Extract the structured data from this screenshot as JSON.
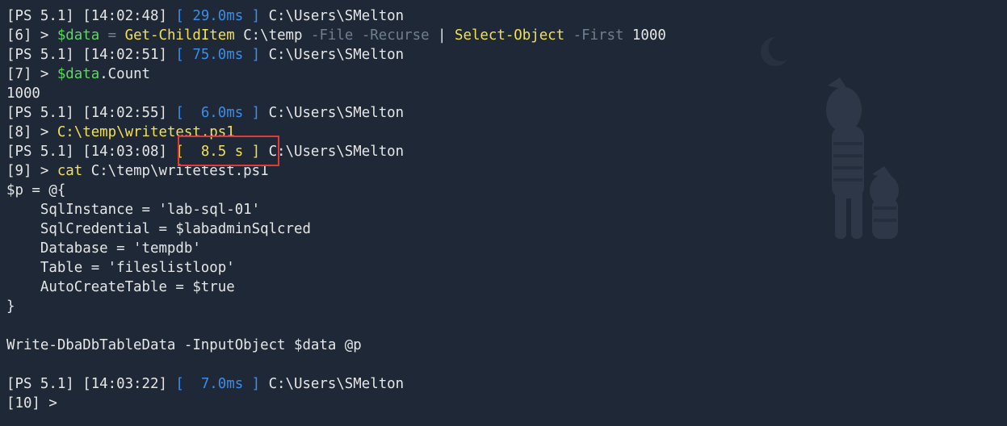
{
  "terminal": {
    "lines": [
      {
        "segs": [
          [
            "[PS 5.1] [14:02:48] ",
            "def"
          ],
          [
            "[ 29.0ms ]",
            "blue"
          ],
          [
            " C:\\Users\\SMelton",
            "def"
          ]
        ]
      },
      {
        "segs": [
          [
            "[6] > ",
            "def"
          ],
          [
            "$data",
            "var"
          ],
          [
            " = ",
            "op"
          ],
          [
            "Get-ChildItem",
            "cmd"
          ],
          [
            " C:\\temp ",
            "def"
          ],
          [
            "-File",
            "param"
          ],
          [
            " ",
            "def"
          ],
          [
            "-Recurse",
            "param"
          ],
          [
            " | ",
            "def"
          ],
          [
            "Select-Object",
            "cmd"
          ],
          [
            " ",
            "def"
          ],
          [
            "-First",
            "param"
          ],
          [
            " 1000",
            "num"
          ]
        ]
      },
      {
        "segs": [
          [
            "[PS 5.1] [14:02:51] ",
            "def"
          ],
          [
            "[ 75.0ms ]",
            "blue"
          ],
          [
            " C:\\Users\\SMelton",
            "def"
          ]
        ]
      },
      {
        "segs": [
          [
            "[7] > ",
            "def"
          ],
          [
            "$data",
            "var"
          ],
          [
            ".Count",
            "def"
          ]
        ]
      },
      {
        "segs": [
          [
            "1000",
            "def"
          ]
        ]
      },
      {
        "segs": [
          [
            "[PS 5.1] [14:02:55] ",
            "def"
          ],
          [
            "[  6.0ms ]",
            "blue"
          ],
          [
            " C:\\Users\\SMelton",
            "def"
          ]
        ]
      },
      {
        "segs": [
          [
            "[8] > ",
            "def"
          ],
          [
            "C:\\temp\\writetest.ps1",
            "yel"
          ]
        ]
      },
      {
        "segs": [
          [
            "[PS 5.1] [14:03:08] ",
            "def"
          ],
          [
            "[  8.5 s ]",
            "yel"
          ],
          [
            " C:\\Users\\SMelton",
            "def"
          ]
        ]
      },
      {
        "segs": [
          [
            "[9] > ",
            "def"
          ],
          [
            "cat",
            "cmd"
          ],
          [
            " C:\\temp\\writetest.ps1",
            "def"
          ]
        ]
      },
      {
        "segs": [
          [
            "$p = @{",
            "def"
          ]
        ]
      },
      {
        "segs": [
          [
            "    SqlInstance = 'lab-sql-01'",
            "def"
          ]
        ]
      },
      {
        "segs": [
          [
            "    SqlCredential = $labadminSqlcred",
            "def"
          ]
        ]
      },
      {
        "segs": [
          [
            "    Database = 'tempdb'",
            "def"
          ]
        ]
      },
      {
        "segs": [
          [
            "    Table = 'fileslistloop'",
            "def"
          ]
        ]
      },
      {
        "segs": [
          [
            "    AutoCreateTable = $true",
            "def"
          ]
        ]
      },
      {
        "segs": [
          [
            "}",
            "def"
          ]
        ]
      },
      {
        "segs": [
          [
            "",
            "def"
          ]
        ]
      },
      {
        "segs": [
          [
            "Write-DbaDbTableData -InputObject $data @p",
            "def"
          ]
        ]
      },
      {
        "segs": [
          [
            "",
            "def"
          ]
        ]
      },
      {
        "segs": [
          [
            "[PS 5.1] [14:03:22] ",
            "def"
          ],
          [
            "[  7.0ms ]",
            "blue"
          ],
          [
            " C:\\Users\\SMelton",
            "def"
          ]
        ]
      },
      {
        "segs": [
          [
            "[10] > ",
            "def"
          ]
        ]
      }
    ]
  },
  "colors": {
    "background": "#1f2836",
    "text": "#e6e6e6",
    "variable": "#5fd75f",
    "command": "#f1e05a",
    "parameter": "#6f7f90",
    "timing": "#3b8eea",
    "highlight_border": "#e03b3b"
  },
  "decorations": {
    "background_image": "calvin-and-hobbes-silhouette",
    "moon_icon": "crescent-moon-icon"
  }
}
